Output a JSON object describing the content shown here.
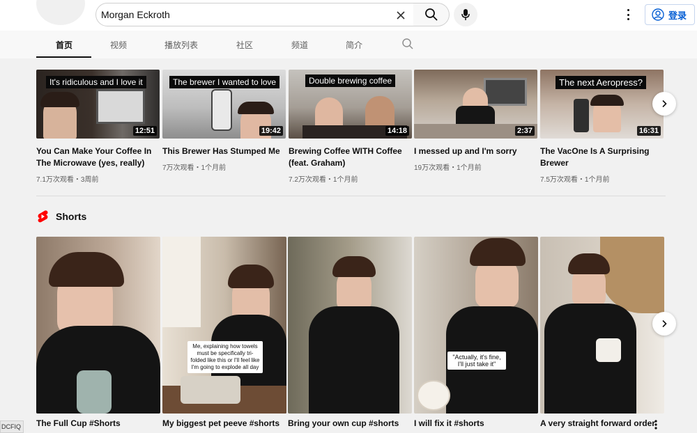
{
  "search": {
    "value": "Morgan Eckroth"
  },
  "header": {
    "login_label": "登录"
  },
  "tabs": [
    {
      "label": "首页"
    },
    {
      "label": "视频"
    },
    {
      "label": "播放列表"
    },
    {
      "label": "社区"
    },
    {
      "label": "频道"
    },
    {
      "label": "简介"
    }
  ],
  "videos": [
    {
      "caption": "It's ridiculous and I love it",
      "duration": "12:51",
      "title": "You Can Make Your Coffee In The Microwave (yes, really)",
      "meta": "7.1万次观看・3周前"
    },
    {
      "caption": "The brewer I wanted to love",
      "duration": "19:42",
      "title": "This Brewer Has Stumped Me",
      "meta": "7万次观看・1个月前"
    },
    {
      "caption": "Double brewing coffee",
      "duration": "14:18",
      "title": "Brewing Coffee WITH Coffee (feat. Graham)",
      "meta": "7.2万次观看・1个月前"
    },
    {
      "caption": "",
      "duration": "2:37",
      "title": "I messed up and I'm sorry",
      "meta": "19万次观看・1个月前"
    },
    {
      "caption": "The next Aeropress?",
      "duration": "16:31",
      "title": "The VacOne Is A Surprising Brewer",
      "meta": "7.5万次观看・1个月前"
    }
  ],
  "shorts_section": {
    "title": "Shorts"
  },
  "shorts": [
    {
      "title": "The Full Cup #Shorts",
      "overlay": ""
    },
    {
      "title": "My biggest pet peeve #shorts",
      "overlay": "Me, explaining how towels must be specifically tri-folded like this or I'll feel like I'm going to explode all day"
    },
    {
      "title": "Bring your own cup #shorts",
      "overlay": ""
    },
    {
      "title": "I will fix it #shorts",
      "overlay": "\"Actually, it's fine, I'll just take it\""
    },
    {
      "title": "A very straight forward order",
      "overlay": ""
    }
  ],
  "corner_tag": "DCFIQ",
  "colors": {
    "accent": "#065fd4",
    "shorts_red": "#ff0000",
    "background": "#f1f1f1"
  }
}
